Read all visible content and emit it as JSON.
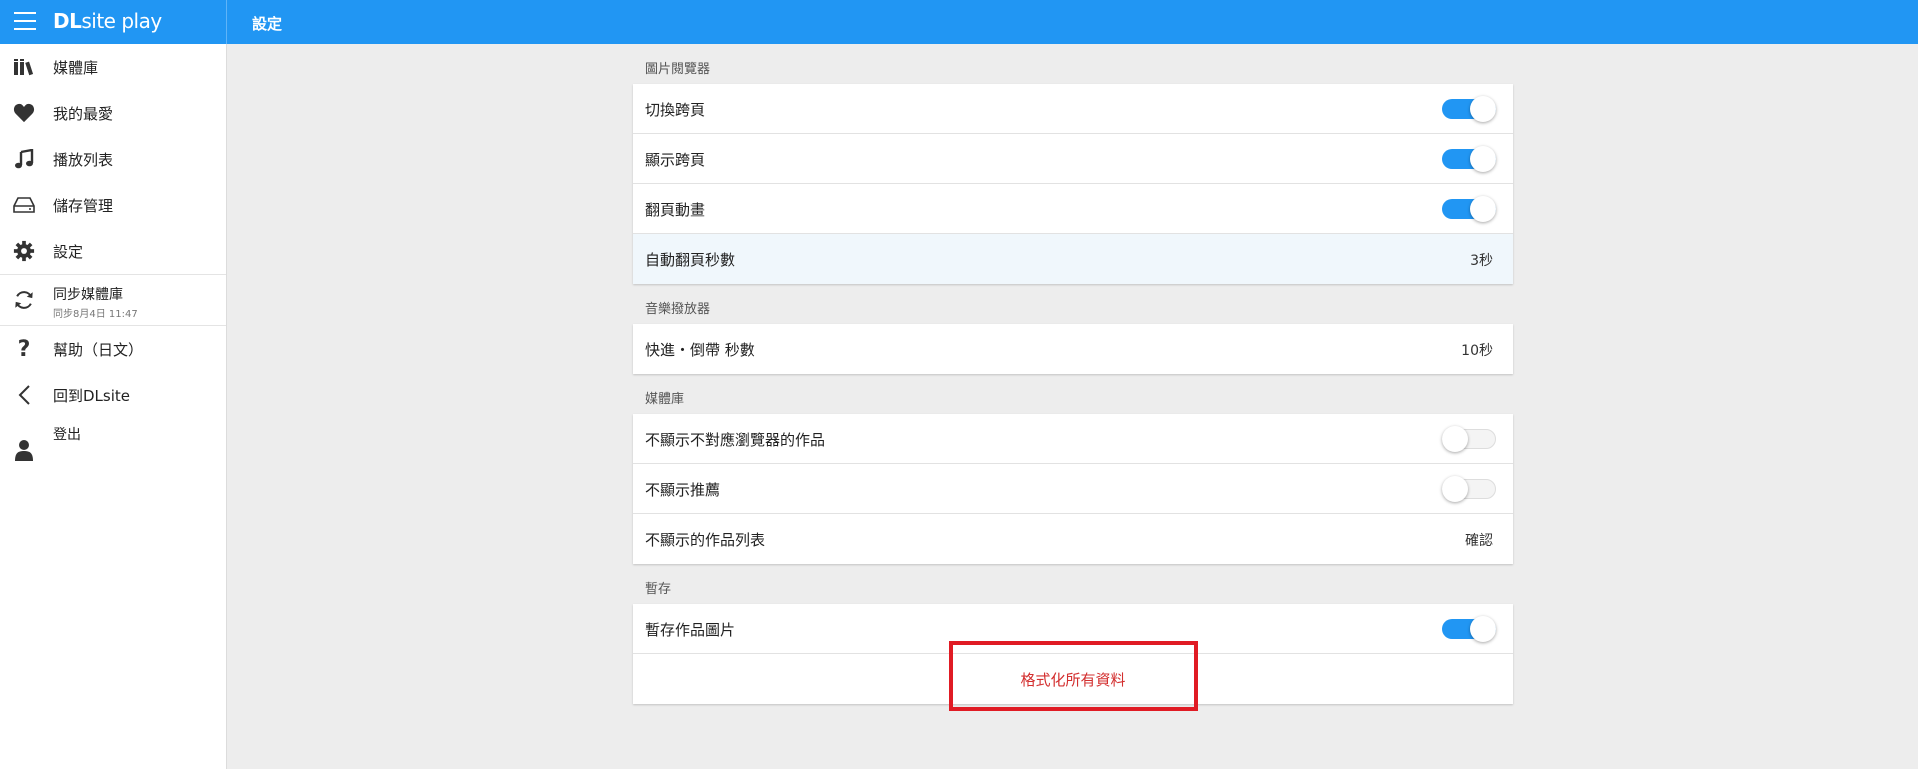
{
  "header": {
    "brand_main": "DL",
    "brand_rest": "site play",
    "title": "設定"
  },
  "sidebar": {
    "items": [
      {
        "icon": "library-icon",
        "label": "媒體庫"
      },
      {
        "icon": "heart-icon",
        "label": "我的最愛"
      },
      {
        "icon": "music-note-icon",
        "label": "播放列表"
      },
      {
        "icon": "storage-icon",
        "label": "儲存管理"
      },
      {
        "icon": "gear-icon",
        "label": "設定"
      }
    ],
    "sync": {
      "icon": "sync-icon",
      "label": "同步媒體庫",
      "sub": "同步8月4日 11:47"
    },
    "bottom_items": [
      {
        "icon": "help-icon",
        "label": "幫助（日文）"
      },
      {
        "icon": "chevron-left-icon",
        "label": "回到DLsite"
      },
      {
        "icon": "user-icon",
        "label": "登出"
      }
    ]
  },
  "sections": {
    "image_viewer": {
      "heading": "圖片閱覽器",
      "rows": [
        {
          "label": "切換跨頁",
          "toggle": "on"
        },
        {
          "label": "顯示跨頁",
          "toggle": "on"
        },
        {
          "label": "翻頁動畫",
          "toggle": "on"
        },
        {
          "label": "自動翻頁秒數",
          "value": "3秒"
        }
      ]
    },
    "music_player": {
      "heading": "音樂撥放器",
      "rows": [
        {
          "label": "快進・倒帶 秒數",
          "value": "10秒"
        }
      ]
    },
    "library": {
      "heading": "媒體庫",
      "rows": [
        {
          "label": "不顯示不對應瀏覽器的作品",
          "toggle": "off"
        },
        {
          "label": "不顯示推薦",
          "toggle": "off"
        },
        {
          "label": "不顯示的作品列表",
          "value": "確認"
        }
      ]
    },
    "cache": {
      "heading": "暫存",
      "rows": [
        {
          "label": "暫存作品圖片",
          "toggle": "on"
        }
      ],
      "format_label": "格式化所有資料"
    }
  },
  "colors": {
    "accent": "#2196f3",
    "danger": "#d32f2f",
    "annotation": "#e01b24"
  }
}
